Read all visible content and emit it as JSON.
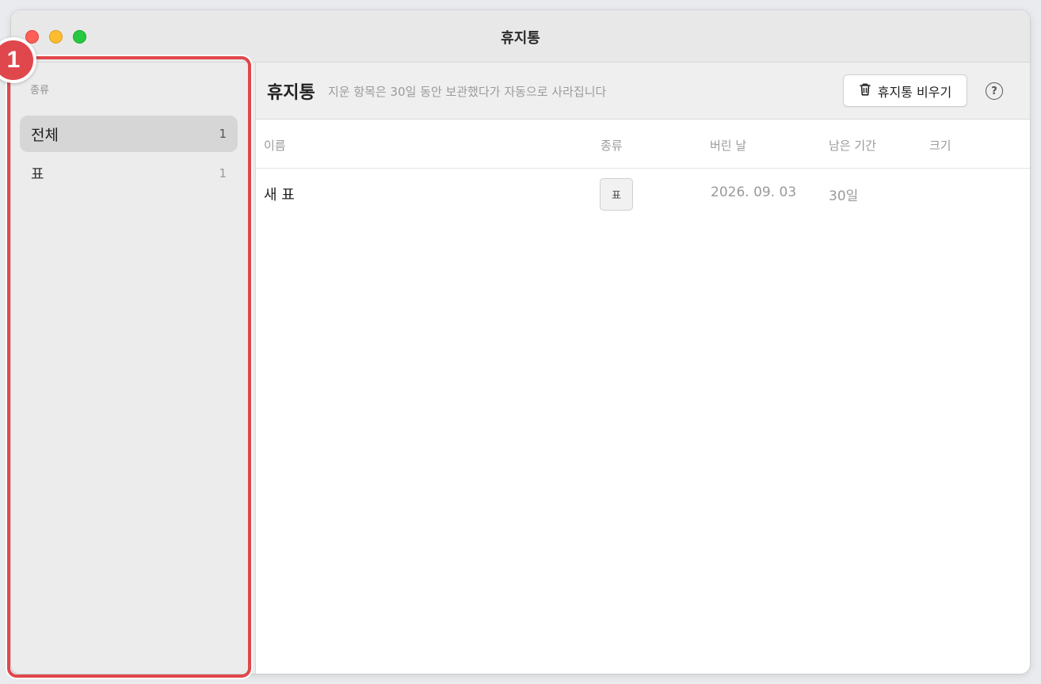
{
  "window": {
    "title": "휴지통"
  },
  "sidebar": {
    "heading": "종류",
    "items": [
      {
        "label": "전체",
        "count": "1",
        "active": true
      },
      {
        "label": "표",
        "count": "1",
        "active": false
      }
    ]
  },
  "annotation": {
    "marker_label": "1",
    "color": "#e0474c"
  },
  "header": {
    "title": "휴지통",
    "subtitle": "지운 항목은 30일 동안 보관했다가 자동으로 사라집니다",
    "empty_button_label": "휴지통 비우기",
    "empty_button_icon": "trash-icon",
    "help_icon": "question-circle-icon",
    "help_glyph": "?"
  },
  "table": {
    "columns": [
      "이름",
      "종류",
      "버린 날",
      "남은 기간",
      "크기"
    ],
    "rows": [
      {
        "name": "새 표",
        "type": "표",
        "deleted_date": "2026. 09. 03",
        "remaining": "30일",
        "size": ""
      }
    ]
  }
}
